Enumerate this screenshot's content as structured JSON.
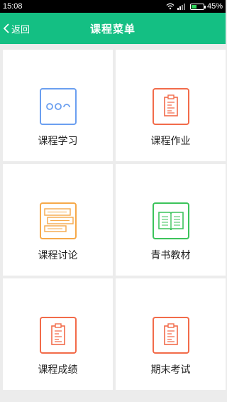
{
  "status_bar": {
    "time": "15:08",
    "battery_percent": "45%",
    "battery_level": 0.45,
    "icons": [
      "wifi-icon",
      "signal-icon",
      "battery-icon"
    ]
  },
  "header": {
    "back_label": "返回",
    "title": "课程菜单",
    "background": "#14bf83"
  },
  "menu": [
    {
      "label": "课程学习",
      "icon": "chat-dots-icon",
      "color": "#6b9ff0"
    },
    {
      "label": "课程作业",
      "icon": "clipboard-icon",
      "color": "#f26b4a"
    },
    {
      "label": "课程讨论",
      "icon": "discussion-icon",
      "color": "#f6a94a"
    },
    {
      "label": "青书教材",
      "icon": "book-icon",
      "color": "#3cc35b"
    },
    {
      "label": "课程成绩",
      "icon": "clipboard-icon",
      "color": "#f26b4a"
    },
    {
      "label": "期末考试",
      "icon": "clipboard-icon",
      "color": "#f26b4a"
    }
  ]
}
